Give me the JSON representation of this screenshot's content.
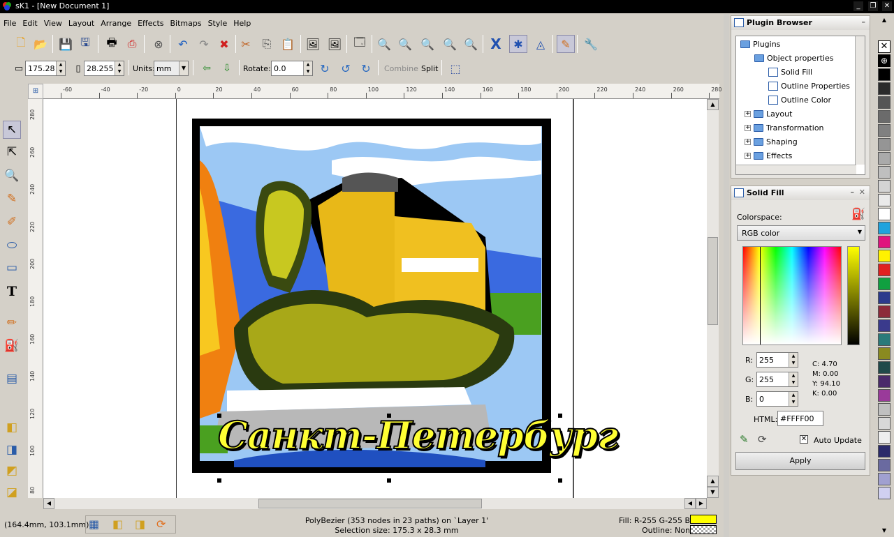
{
  "window": {
    "title": "sK1 - [New Document 1]"
  },
  "menu": [
    "File",
    "Edit",
    "View",
    "Layout",
    "Arrange",
    "Effects",
    "Bitmaps",
    "Style",
    "Help"
  ],
  "toolbar2": {
    "width": "175.28",
    "height": "28.255",
    "units_label": "Units:",
    "units_value": "mm",
    "rotate_label": "Rotate:",
    "rotate_value": "0.0",
    "combine": "Combine",
    "split": "Split"
  },
  "ruler_top": [
    "-60",
    "-40",
    "-20",
    "0",
    "20",
    "40",
    "60",
    "80",
    "100",
    "120",
    "140",
    "160",
    "180",
    "200",
    "220",
    "240",
    "260",
    "280"
  ],
  "ruler_left": [
    "280",
    "260",
    "240",
    "220",
    "200",
    "180",
    "160",
    "140",
    "120",
    "100",
    "80"
  ],
  "artwork_text": "Санкт-Петербург",
  "plugin_browser": {
    "title": "Plugin Browser",
    "items": [
      {
        "label": "Plugins",
        "type": "folder",
        "level": 0
      },
      {
        "label": "Object properties",
        "type": "folder",
        "level": 1
      },
      {
        "label": "Solid Fill",
        "type": "doc",
        "level": 2
      },
      {
        "label": "Outline Properties",
        "type": "doc",
        "level": 2
      },
      {
        "label": "Outline Color",
        "type": "doc",
        "level": 2
      },
      {
        "label": "Layout",
        "type": "folder",
        "level": 1
      },
      {
        "label": "Transformation",
        "type": "folder",
        "level": 1
      },
      {
        "label": "Shaping",
        "type": "folder",
        "level": 1
      },
      {
        "label": "Effects",
        "type": "folder",
        "level": 1
      }
    ]
  },
  "solid_fill": {
    "title": "Solid Fill",
    "colorspace_label": "Colorspace:",
    "colorspace_value": "RGB color",
    "r_label": "R:",
    "r": "255",
    "g_label": "G:",
    "g": "255",
    "b_label": "B:",
    "b": "0",
    "c": "C: 4.70",
    "m": "M: 0.00",
    "y": "Y: 94.10",
    "k": "K: 0.00",
    "html_label": "HTML:",
    "html": "#FFFF00",
    "auto_update": "Auto Update",
    "apply": "Apply"
  },
  "palette": [
    "#000000",
    "#2b2b2b",
    "#555555",
    "#6b6b6b",
    "#808080",
    "#959595",
    "#aaaaaa",
    "#bfbfbf",
    "#d4d4d4",
    "#eaeaea",
    "#ffffff",
    "#1fa3dd",
    "#e0137e",
    "#fff200",
    "#e02020",
    "#10a040",
    "#2c3a8c",
    "#8c2a3a",
    "#3a3a8c",
    "#2a7a7a",
    "#8a8a20",
    "#204a4a",
    "#4a2a6a",
    "#9a3a9a",
    "#c0c0c0",
    "#d8d8d8",
    "#eeeeee",
    "#2a2a6a",
    "#6a6aa0",
    "#a0a0d0",
    "#d0d0f0"
  ],
  "status": {
    "coords": "(164.4mm, 103.1mm)",
    "object": "PolyBezier (353 nodes in 23 paths) on `Layer 1'",
    "selection": "Selection size: 175.3 x 28.3 mm",
    "fill": "Fill: R-255 G-255 B-0",
    "outline": "Outline: None",
    "fill_color": "#ffff00"
  }
}
